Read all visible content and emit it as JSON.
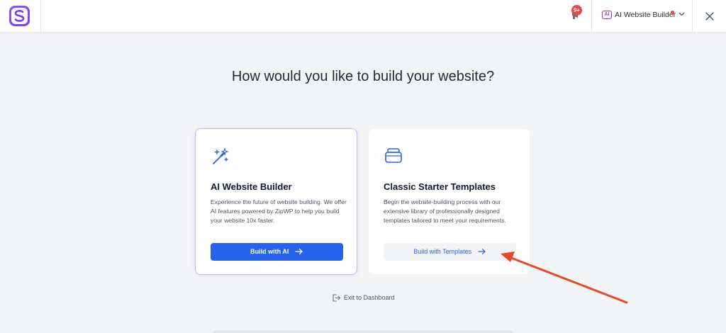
{
  "header": {
    "notification_count": "9+",
    "builder_icon_text": "AI",
    "builder_label": "AI Website Builder"
  },
  "main": {
    "heading": "How would you like to build your website?",
    "cards": [
      {
        "title": "AI Website Builder",
        "description": "Experience the future of website building. We offer AI features powered by ZipWP to help you build your website 10x faster.",
        "button_label": "Build with AI"
      },
      {
        "title": "Classic Starter Templates",
        "description": "Begin the website-building process with our extensive library of professionally designed templates tailored to meet your requirements.",
        "button_label": "Build with Templates"
      }
    ],
    "exit_label": "Exit to Dashboard"
  },
  "colors": {
    "primary": "#2563eb",
    "accent": "#7c3aed",
    "badge": "#ef4444",
    "annotation_arrow": "#e8472c"
  },
  "icons": [
    "logo-icon",
    "megaphone-icon",
    "ai-chip-icon",
    "chevron-down-icon",
    "close-icon",
    "magic-wand-icon",
    "stack-icon",
    "arrow-right-icon",
    "exit-icon"
  ]
}
